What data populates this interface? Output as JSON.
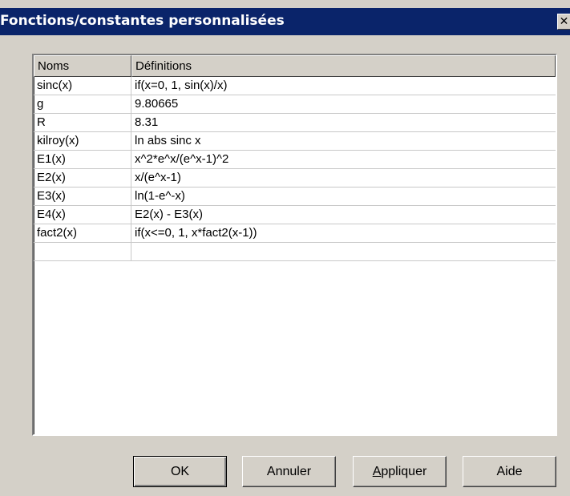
{
  "dialog": {
    "title": "Fonctions/constantes personnalisées",
    "close_glyph": "✕"
  },
  "table": {
    "columns": [
      "Noms",
      "Définitions"
    ],
    "rows": [
      {
        "name": "sinc(x)",
        "definition": "if(x=0, 1, sin(x)/x)"
      },
      {
        "name": "g",
        "definition": "9.80665"
      },
      {
        "name": "R",
        "definition": "8.31"
      },
      {
        "name": "kilroy(x)",
        "definition": "ln abs sinc x"
      },
      {
        "name": "E1(x)",
        "definition": "x^2*e^x/(e^x-1)^2"
      },
      {
        "name": "E2(x)",
        "definition": "x/(e^x-1)"
      },
      {
        "name": "E3(x)",
        "definition": "ln(1-e^-x)"
      },
      {
        "name": "E4(x)",
        "definition": "E2(x) - E3(x)"
      },
      {
        "name": "fact2(x)",
        "definition": "if(x<=0, 1, x*fact2(x-1))"
      },
      {
        "name": "",
        "definition": ""
      }
    ]
  },
  "buttons": {
    "ok": "OK",
    "cancel": "Annuler",
    "apply_mnemonic": "A",
    "apply_rest": "ppliquer",
    "help": "Aide"
  }
}
